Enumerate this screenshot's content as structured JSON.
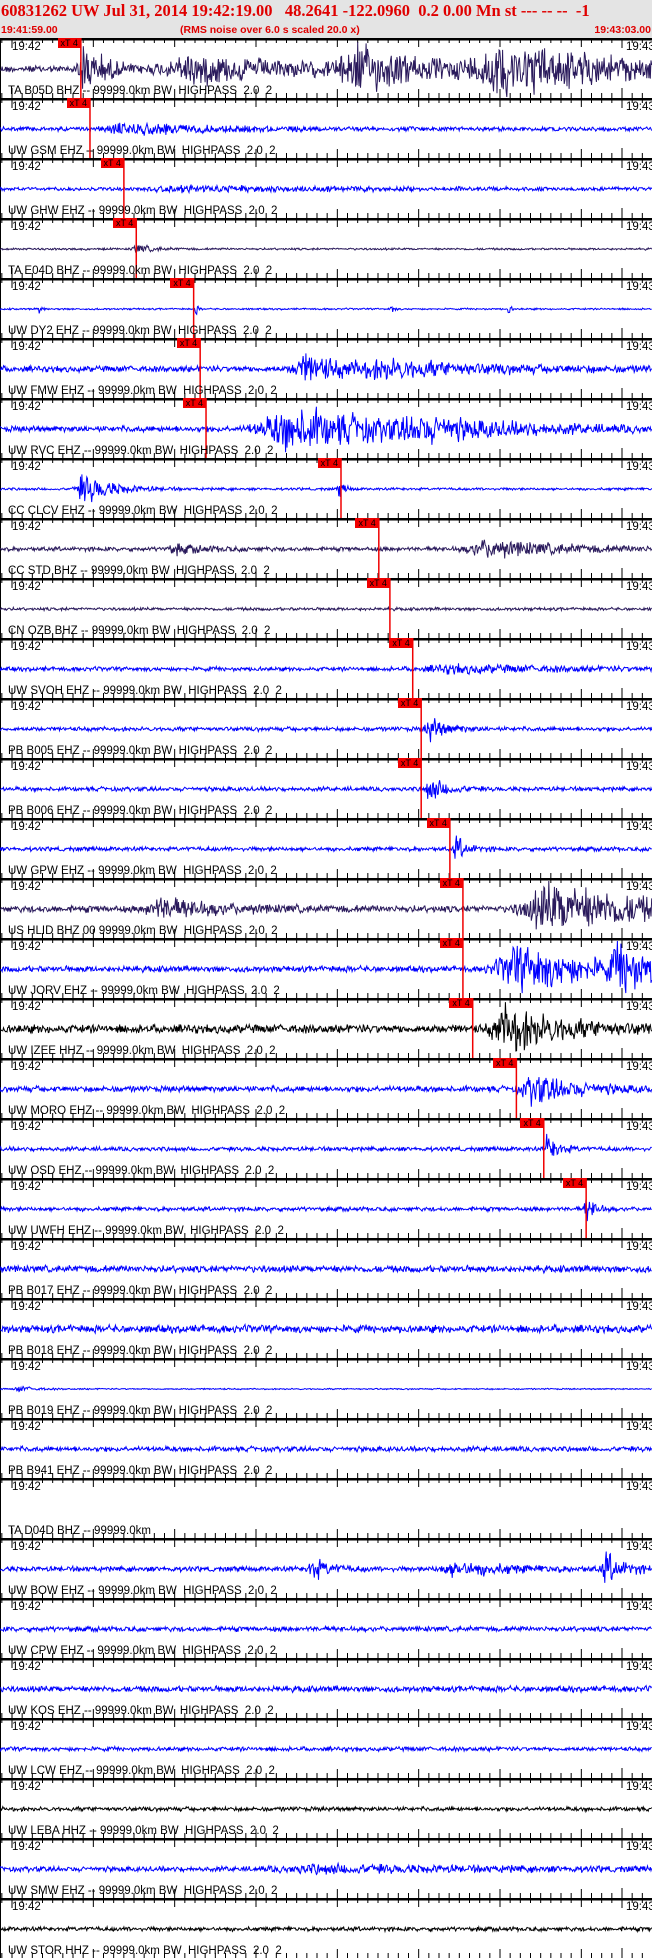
{
  "header": {
    "title": "60831262 UW Jul 31, 2014 19:42:19.00   48.2641 -122.0960  0.2 0.00 Mn st --- -- --  -1",
    "start_time": "19:41:59.00",
    "note": "(RMS noise over 6.0 s scaled 20.0 x)",
    "end_time": "19:43:03.00"
  },
  "axis": {
    "minute_left": "19:42",
    "minute_right": "19:43"
  },
  "colors": {
    "navy": "#2a1a5c",
    "blue": "#0000ff",
    "black": "#000000",
    "pick": "#f00000",
    "header_text": "#e00000"
  },
  "traces": [
    {
      "label": "TA B05D BHZ -- 99999.0km BW  HIGHPASS  2.0  2",
      "color": "navy",
      "noise": 4,
      "events": [
        [
          0.13,
          28,
          0.04
        ],
        [
          0.3,
          16,
          0.2
        ],
        [
          0.55,
          24,
          0.12
        ],
        [
          0.78,
          28,
          0.22
        ]
      ],
      "pick": {
        "text": "xT 4",
        "frac": 0.124
      }
    },
    {
      "label": "UW GSM EHZ -- 99999.0km BW  HIGHPASS  2.0  2",
      "color": "blue",
      "noise": 2.5,
      "events": [
        [
          0.2,
          6,
          0.15
        ]
      ],
      "pick": {
        "text": "xT 4",
        "frac": 0.138
      }
    },
    {
      "label": "UW GHW EHZ -- 99999.0km BW  HIGHPASS  2.0  2",
      "color": "blue",
      "noise": 2,
      "events": [
        [
          0.3,
          3,
          0.3
        ]
      ],
      "pick": {
        "text": "xT 4",
        "frac": 0.19
      }
    },
    {
      "label": "TA E04D BHZ -- 99999.0km BW  HIGHPASS  2.0  2",
      "color": "navy",
      "noise": 1.2,
      "events": [
        [
          0.21,
          5,
          0.03
        ]
      ],
      "pick": {
        "text": "xT 4",
        "frac": 0.209
      }
    },
    {
      "label": "UW DY2 EHZ -- 99999.0km BW  HIGHPASS  2.0  2",
      "color": "blue",
      "noise": 1,
      "events": [
        [
          0.06,
          8,
          0.004
        ],
        [
          0.3,
          8,
          0.004
        ],
        [
          0.6,
          8,
          0.004
        ],
        [
          0.78,
          8,
          0.004
        ]
      ],
      "pick": {
        "text": "xT 4",
        "frac": 0.297
      }
    },
    {
      "label": "UW FMW EHZ -- 99999.0km BW  HIGHPASS  2.0  2",
      "color": "blue",
      "noise": 3.5,
      "events": [
        [
          0.47,
          16,
          0.08
        ],
        [
          0.6,
          8,
          0.2
        ]
      ],
      "pick": {
        "text": "xT 4",
        "frac": 0.307
      }
    },
    {
      "label": "UW RVC EHZ -- 99999.0km BW  HIGHPASS  2.0  2",
      "color": "blue",
      "noise": 3.5,
      "events": [
        [
          0.45,
          24,
          0.2
        ],
        [
          0.65,
          8,
          0.15
        ]
      ],
      "pick": {
        "text": "xT 4",
        "frac": 0.316
      }
    },
    {
      "label": "CC CLCV EHZ -- 99999.0km BW  HIGHPASS  2.0  2",
      "color": "blue",
      "noise": 1.5,
      "events": [
        [
          0.13,
          18,
          0.05
        ],
        [
          0.52,
          10,
          0.01
        ]
      ],
      "pick": {
        "text": "xT 4",
        "frac": 0.523
      }
    },
    {
      "label": "CC STD BHZ -- 99999.0km BW  HIGHPASS  2.0  2",
      "color": "navy",
      "noise": 2.5,
      "events": [
        [
          0.27,
          5,
          0.06
        ],
        [
          0.75,
          10,
          0.14
        ]
      ],
      "pick": {
        "text": "xT 4",
        "frac": 0.581
      }
    },
    {
      "label": "CN OZB BHZ -- 99999.0km BW  HIGHPASS  2.0  2",
      "color": "navy",
      "noise": 1.8,
      "events": [],
      "pick": {
        "text": "xT 4",
        "frac": 0.598
      }
    },
    {
      "label": "UW SVOH EHZ -- 99999.0km BW  HIGHPASS  2.0  2",
      "color": "blue",
      "noise": 2.5,
      "events": [
        [
          0.7,
          4,
          0.2
        ]
      ],
      "pick": {
        "text": "xT 4",
        "frac": 0.633
      }
    },
    {
      "label": "PB B005 EHZ -- 99999.0km BW  HIGHPASS  2.0  2",
      "color": "blue",
      "noise": 2.5,
      "events": [
        [
          0.66,
          14,
          0.03
        ]
      ],
      "pick": {
        "text": "xT 4",
        "frac": 0.646
      }
    },
    {
      "label": "PB B006 EHZ -- 99999.0km BW  HIGHPASS  2.0  2",
      "color": "blue",
      "noise": 2.5,
      "events": [
        [
          0.66,
          14,
          0.03
        ]
      ],
      "pick": {
        "text": "xT 4",
        "frac": 0.646
      }
    },
    {
      "label": "UW GPW EHZ -- 99999.0km BW  HIGHPASS  2.0  2",
      "color": "blue",
      "noise": 2.5,
      "events": [
        [
          0.7,
          14,
          0.02
        ]
      ],
      "pick": {
        "text": "xT 4",
        "frac": 0.69
      }
    },
    {
      "label": "US HLID BHZ 00 99999.0km BW  HIGHPASS  2.0  2",
      "color": "navy",
      "noise": 4,
      "events": [
        [
          0.25,
          12,
          0.1
        ],
        [
          0.85,
          30,
          0.18
        ]
      ],
      "pick": {
        "text": "xT 4",
        "frac": 0.71
      }
    },
    {
      "label": "UW JORV EHZ -- 99999.0km BW  HIGHPASS  2.0  2",
      "color": "blue",
      "noise": 3.5,
      "events": [
        [
          0.8,
          26,
          0.15
        ],
        [
          0.95,
          26,
          0.05
        ]
      ],
      "pick": {
        "text": "xT 4",
        "frac": 0.71
      }
    },
    {
      "label": "UW IZEE HHZ -- 99999.0km BW  HIGHPASS  2.0  2",
      "color": "black",
      "noise": 5,
      "events": [
        [
          0.78,
          26,
          0.1
        ]
      ],
      "pick": {
        "text": "xT 4",
        "frac": 0.725
      }
    },
    {
      "label": "UW MORO EHZ -- 99999.0km BW  HIGHPASS  2.0  2",
      "color": "blue",
      "noise": 3.5,
      "events": [
        [
          0.82,
          16,
          0.08
        ]
      ],
      "pick": {
        "text": "xT 4",
        "frac": 0.792
      }
    },
    {
      "label": "UW OSD EHZ -- 99999.0km BW  HIGHPASS  2.0  2",
      "color": "blue",
      "noise": 2.5,
      "events": [
        [
          0.84,
          16,
          0.02
        ]
      ],
      "pick": {
        "text": "xT 4",
        "frac": 0.834
      }
    },
    {
      "label": "UW UWFH EHZ -- 99999.0km BW  HIGHPASS  2.0  2",
      "color": "blue",
      "noise": 2.5,
      "events": [
        [
          0.9,
          16,
          0.015
        ]
      ],
      "pick": {
        "text": "xT 4",
        "frac": 0.899
      }
    },
    {
      "label": "PB B017 EHZ -- 99999.0km BW  HIGHPASS  2.0  2",
      "color": "blue",
      "noise": 4,
      "events": []
    },
    {
      "label": "PB B018 EHZ -- 99999.0km BW  HIGHPASS  2.0  2",
      "color": "blue",
      "noise": 4.5,
      "events": []
    },
    {
      "label": "PB B019 EHZ -- 99999.0km BW  HIGHPASS  2.0  2",
      "color": "blue",
      "noise": 0.8,
      "events": [
        [
          0.03,
          3,
          0.03
        ]
      ]
    },
    {
      "label": "PB B941 EHZ -- 99999.0km BW  HIGHPASS  2.0  2",
      "color": "blue",
      "noise": 3,
      "events": []
    },
    {
      "label": "TA D04D BHZ -- 99999.0km",
      "color": "none",
      "noise": 0,
      "events": []
    },
    {
      "label": "UW BOW EHZ -- 99999.0km BW  HIGHPASS  2.0  2",
      "color": "blue",
      "noise": 3,
      "events": [
        [
          0.48,
          12,
          0.03
        ],
        [
          0.7,
          8,
          0.1
        ],
        [
          0.93,
          18,
          0.03
        ]
      ]
    },
    {
      "label": "UW CPW EHZ -- 99999.0km BW  HIGHPASS  2.0  2",
      "color": "blue",
      "noise": 3,
      "events": []
    },
    {
      "label": "UW KOS EHZ -- 99999.0km BW  HIGHPASS  2.0  2",
      "color": "blue",
      "noise": 3.5,
      "events": []
    },
    {
      "label": "UW LCW EHZ -- 99999.0km BW  HIGHPASS  2.0  2",
      "color": "blue",
      "noise": 2.5,
      "events": []
    },
    {
      "label": "UW LEBA HHZ -- 99999.0km BW  HIGHPASS  2.0  2",
      "color": "black",
      "noise": 2.5,
      "events": []
    },
    {
      "label": "UW SMW EHZ -- 99999.0km BW  HIGHPASS  2.0  2",
      "color": "blue",
      "noise": 3,
      "events": [
        [
          0.5,
          4,
          0.3
        ]
      ]
    },
    {
      "label": "UW STOR HHZ -- 99999.0km BW  HIGHPASS  2.0  2",
      "color": "black",
      "noise": 2.5,
      "events": []
    }
  ]
}
